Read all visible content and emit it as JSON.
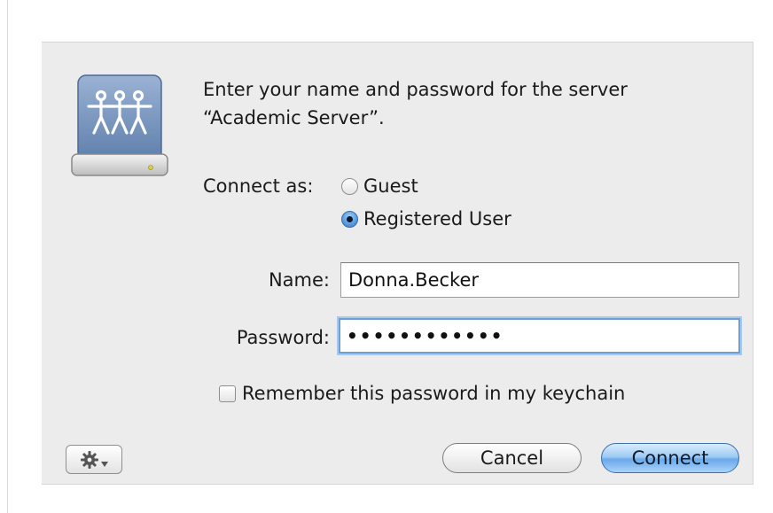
{
  "dialog": {
    "prompt_line1": "Enter your name and password for the server",
    "prompt_line2": "“Academic Server”.",
    "connect_as_label": "Connect as:",
    "options": {
      "guest": "Guest",
      "registered": "Registered User",
      "selected": "Registered User"
    },
    "name_label": "Name:",
    "name_value": "Donna.Becker",
    "password_label": "Password:",
    "password_masked": "••••••••••••",
    "remember_label": "Remember this password in my keychain",
    "remember_checked": false,
    "cancel_label": "Cancel",
    "connect_label": "Connect",
    "icons": {
      "server": "network-drive-icon",
      "action": "gear-menu-icon"
    }
  }
}
